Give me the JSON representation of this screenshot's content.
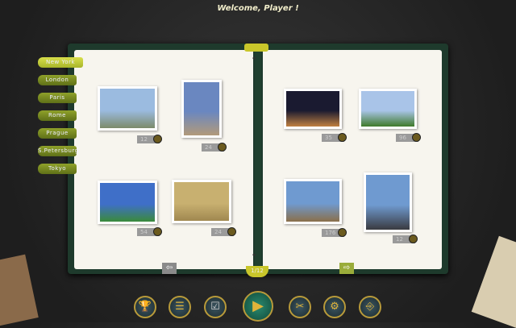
{
  "header": {
    "title": "Welcome, Player !"
  },
  "cities": [
    "New York",
    "London",
    "Paris",
    "Rome",
    "Prague",
    "S.Petersburg",
    "Tokyo"
  ],
  "active_city": "New York",
  "photos": [
    {
      "count": "12",
      "colors": [
        "#9bbbe0",
        "#7c8a6a"
      ]
    },
    {
      "count": "24",
      "colors": [
        "#6a87c0",
        "#b29a7a"
      ]
    },
    {
      "count": "54",
      "colors": [
        "#3f6fc8",
        "#3a8a3a"
      ]
    },
    {
      "count": "24",
      "colors": [
        "#c8b070",
        "#a08850"
      ]
    },
    {
      "count": "35",
      "colors": [
        "#1a1a30",
        "#c08040"
      ]
    },
    {
      "count": "96",
      "colors": [
        "#a9c4e8",
        "#3f7a2a"
      ]
    },
    {
      "count": "176",
      "colors": [
        "#6f9ad0",
        "#8a6f4a"
      ]
    },
    {
      "count": "12",
      "colors": [
        "#6f9ad0",
        "#3a3a40"
      ]
    }
  ],
  "page_indicator": "1/12",
  "nav": {
    "prev": "⇦",
    "next": "⇨"
  },
  "toolbar": {
    "trophy": "🏆",
    "list": "☰",
    "check": "☑",
    "play": "▶",
    "scissors": "✂",
    "settings": "⚙",
    "exit": "⎆"
  }
}
